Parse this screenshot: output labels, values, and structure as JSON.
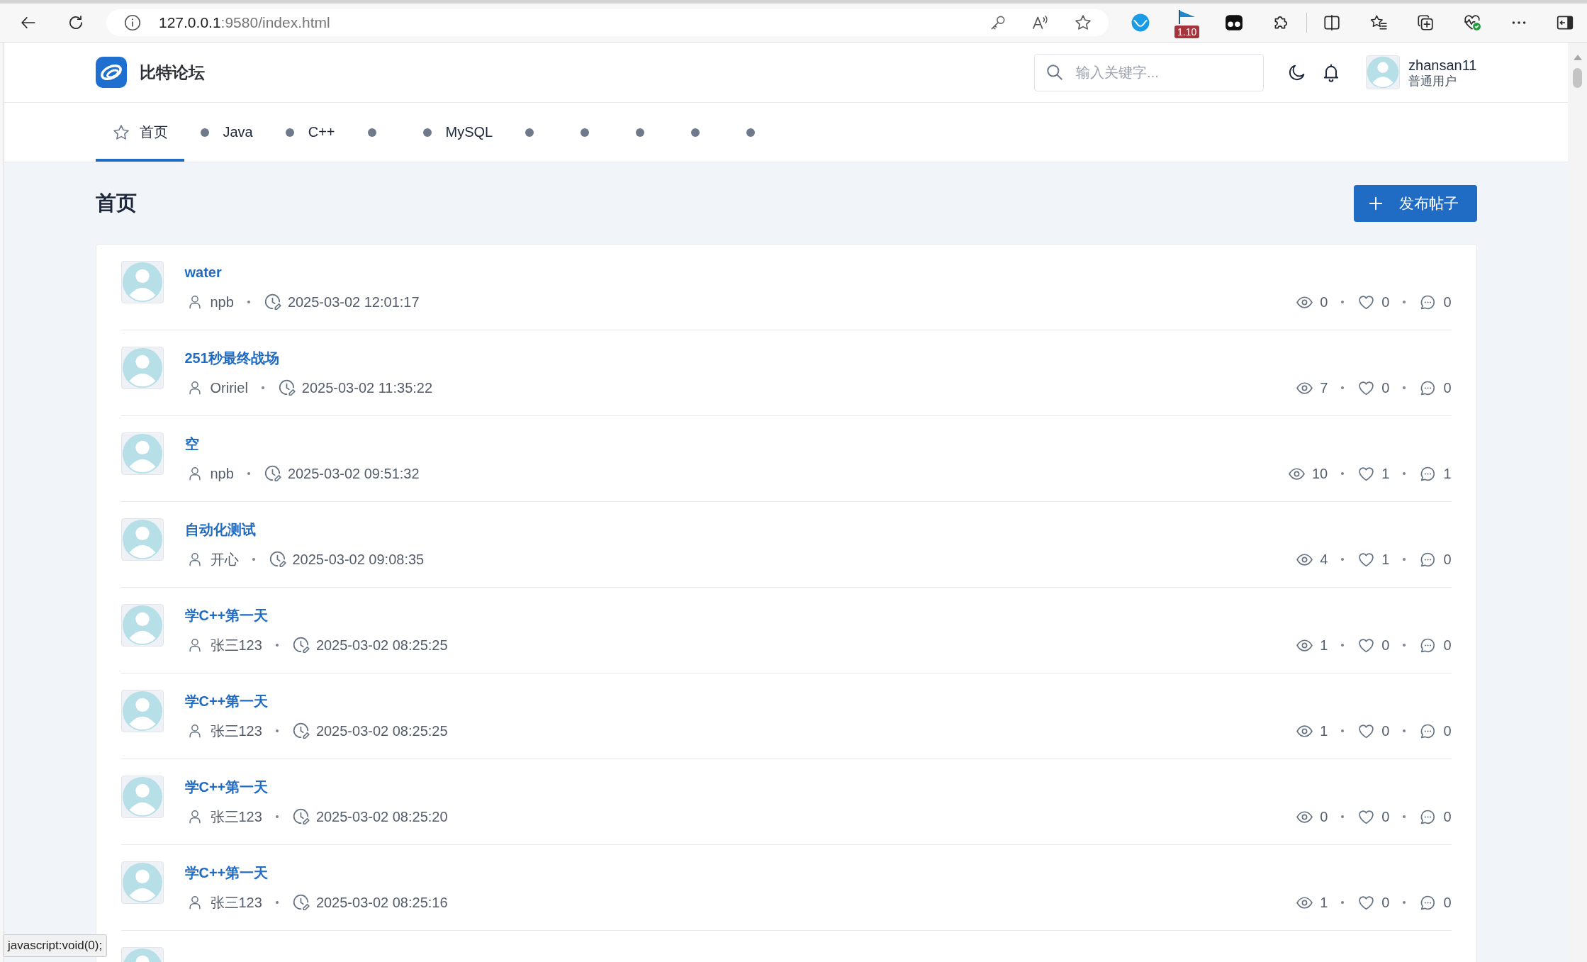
{
  "browser": {
    "url_host": "127.0.0.1",
    "url_path": ":9580/index.html",
    "extension_badge": "1.10",
    "status_text": "javascript:void(0);"
  },
  "header": {
    "site_name": "比特论坛",
    "search": {
      "placeholder": "输入关键字..."
    },
    "user": {
      "name": "zhansan11",
      "role": "普通用户"
    }
  },
  "nav": [
    {
      "kind": "home",
      "label": "首页",
      "selected": true
    },
    {
      "kind": "board",
      "label": "Java",
      "selected": false
    },
    {
      "kind": "board",
      "label": "C++",
      "selected": false
    },
    {
      "kind": "board",
      "selected": false
    },
    {
      "kind": "board",
      "label": "MySQL",
      "selected": false
    },
    {
      "kind": "board",
      "selected": false
    },
    {
      "kind": "board",
      "selected": false
    },
    {
      "kind": "board",
      "selected": false
    },
    {
      "kind": "board",
      "selected": false
    },
    {
      "kind": "board",
      "selected": false
    }
  ],
  "page": {
    "title": "首页",
    "new_post_button": "发布帖子"
  },
  "posts": [
    {
      "kind": "post",
      "title": "water",
      "author": "npb",
      "time": "2025-03-02 12:01:17",
      "views": "0",
      "likes": "0",
      "comments": "0"
    },
    {
      "kind": "post",
      "title": "251秒最终战场",
      "author": "Oririel",
      "time": "2025-03-02 11:35:22",
      "views": "7",
      "likes": "0",
      "comments": "0"
    },
    {
      "kind": "post",
      "title": "空",
      "author": "npb",
      "time": "2025-03-02 09:51:32",
      "views": "10",
      "likes": "1",
      "comments": "1"
    },
    {
      "kind": "post",
      "title": "自动化测试",
      "author": "开心",
      "time": "2025-03-02 09:08:35",
      "views": "4",
      "likes": "1",
      "comments": "0"
    },
    {
      "kind": "post",
      "title": "学C++第一天",
      "author": "张三123",
      "time": "2025-03-02 08:25:25",
      "views": "1",
      "likes": "0",
      "comments": "0"
    },
    {
      "kind": "post",
      "title": "学C++第一天",
      "author": "张三123",
      "time": "2025-03-02 08:25:25",
      "views": "1",
      "likes": "0",
      "comments": "0"
    },
    {
      "kind": "post",
      "title": "学C++第一天",
      "author": "张三123",
      "time": "2025-03-02 08:25:20",
      "views": "0",
      "likes": "0",
      "comments": "0"
    },
    {
      "kind": "post",
      "title": "学C++第一天",
      "author": "张三123",
      "time": "2025-03-02 08:25:16",
      "views": "1",
      "likes": "0",
      "comments": "0"
    },
    {
      "kind": "cut_off"
    }
  ]
}
